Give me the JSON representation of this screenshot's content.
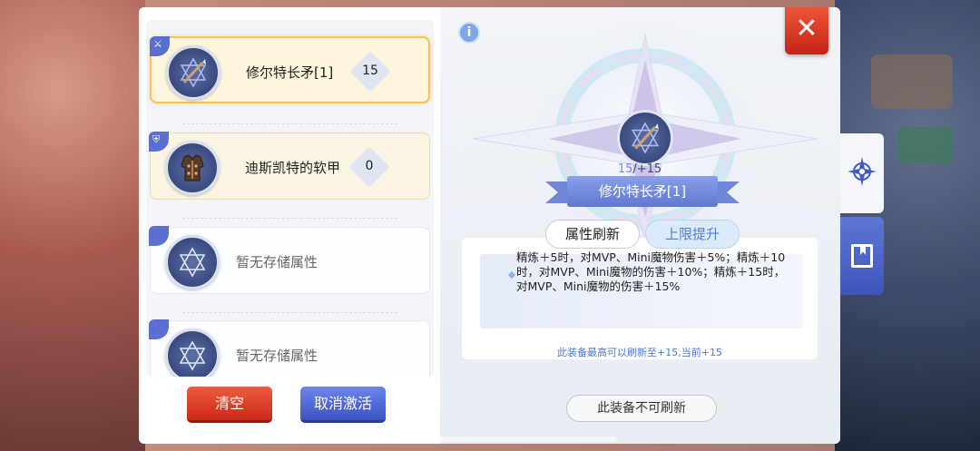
{
  "slots": [
    {
      "name": "修尔特长矛[1]",
      "count": "15",
      "state": "selected",
      "icon": "spear-icon"
    },
    {
      "name": "迪斯凯特的软甲",
      "count": "0",
      "state": "normal",
      "icon": "armor-icon"
    },
    {
      "name": "暂无存储属性",
      "count": "",
      "state": "empty",
      "icon": "star-of-david-icon"
    },
    {
      "name": "暂无存储属性",
      "count": "",
      "state": "empty",
      "icon": "star-of-david-icon"
    }
  ],
  "buttons": {
    "clear": "清空",
    "cancel_activate": "取消激活"
  },
  "detail": {
    "refine_current": "15",
    "refine_max": "/+15",
    "item_name": "修尔特长矛[1]",
    "tab_refresh": "属性刷新",
    "tab_limit_up": "上限提升",
    "description": "精炼＋5时，对MVP、Mini魔物伤害＋5%；精炼＋10时，对MVP、Mini魔物的伤害＋10%；精炼＋15时，对MVP、Mini魔物的伤害＋15%",
    "note": "此装备最高可以刷新至+15,当前+15",
    "bottom_button": "此装备不可刷新"
  },
  "colors": {
    "primary_blue": "#5f77cf",
    "danger_red": "#e2442a",
    "selected_gold": "#f2c45a",
    "link_blue": "#4a78d6"
  }
}
